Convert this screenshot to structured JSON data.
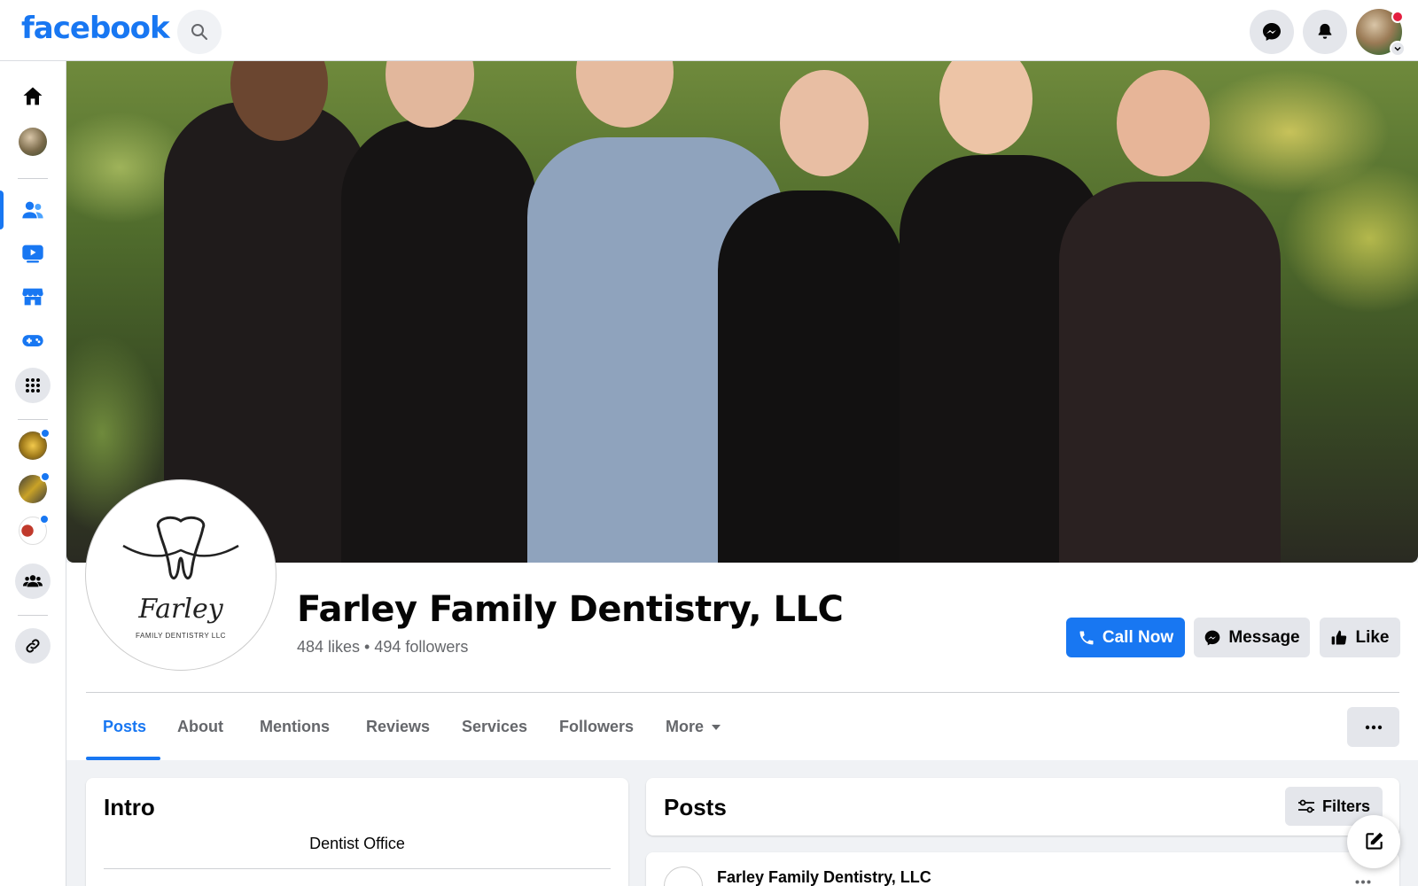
{
  "header": {
    "logo_text": "facebook",
    "icons": [
      "search-icon",
      "messenger-icon",
      "bell-icon",
      "profile-avatar"
    ]
  },
  "leftrail": {
    "items": [
      "home-icon",
      "profile-avatar",
      "friends-icon",
      "watch-icon",
      "marketplace-icon",
      "gaming-icon",
      "menu-grid-icon",
      "shortcut-1",
      "shortcut-2",
      "shortcut-3",
      "groups-icon",
      "link-icon"
    ]
  },
  "profile": {
    "name": "Farley Family Dentistry, LLC",
    "stats": "484 likes • 494 followers",
    "logo_script": "Farley",
    "logo_sub": "FAMILY DENTISTRY LLC"
  },
  "actions": {
    "call_label": "Call Now",
    "message_label": "Message",
    "like_label": "Like"
  },
  "tabs": [
    {
      "label": "Posts",
      "active": true
    },
    {
      "label": "About"
    },
    {
      "label": "Mentions"
    },
    {
      "label": "Reviews"
    },
    {
      "label": "Services"
    },
    {
      "label": "Followers"
    },
    {
      "label": "More"
    }
  ],
  "intro": {
    "title": "Intro",
    "category": "Dentist Office"
  },
  "posts": {
    "title": "Posts",
    "filters_label": "Filters",
    "first_author": "Farley Family Dentistry, LLC"
  },
  "colors": {
    "brand": "#1877f2",
    "notification": "#e41e3f"
  }
}
